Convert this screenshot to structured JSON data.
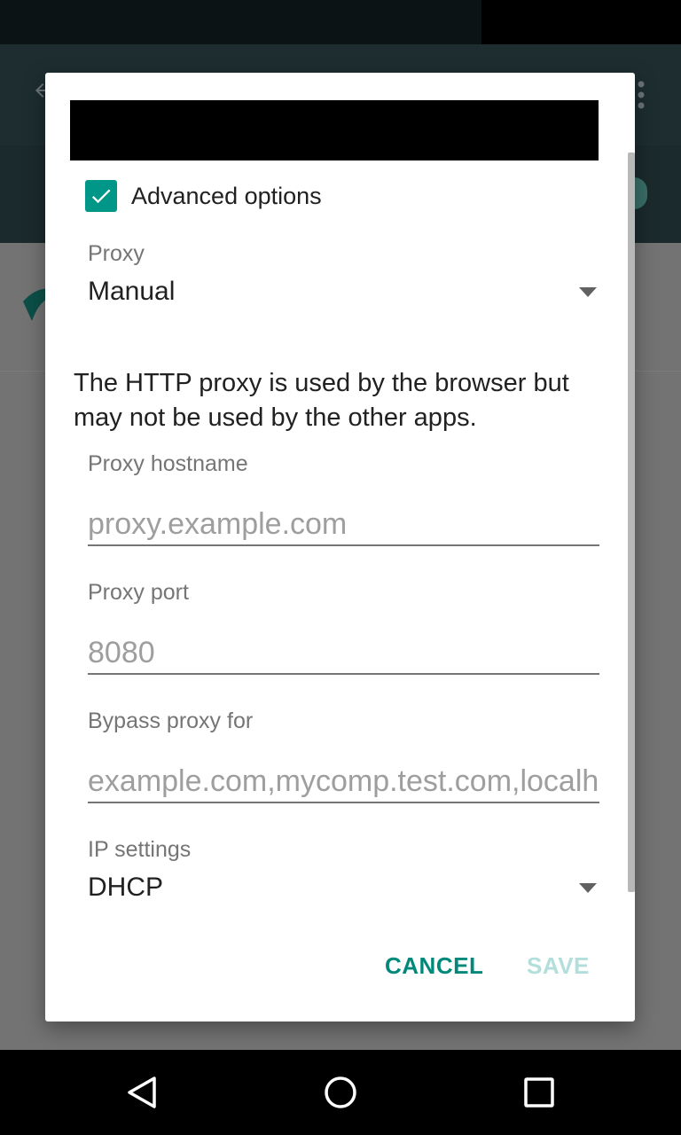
{
  "dialog": {
    "advanced_options_label": "Advanced options",
    "advanced_options_checked": true,
    "proxy": {
      "label": "Proxy",
      "value": "Manual"
    },
    "info_text": "The HTTP proxy is used by the browser but may not be used by the other apps.",
    "proxy_hostname": {
      "label": "Proxy hostname",
      "placeholder": "proxy.example.com"
    },
    "proxy_port": {
      "label": "Proxy port",
      "placeholder": "8080"
    },
    "bypass_proxy": {
      "label": "Bypass proxy for",
      "placeholder": "example.com,mycomp.test.com,localhost"
    },
    "ip_settings": {
      "label": "IP settings",
      "value": "DHCP"
    },
    "buttons": {
      "cancel": "CANCEL",
      "save": "SAVE"
    }
  },
  "colors": {
    "accent": "#009688",
    "accent_disabled": "#b2dfdb",
    "app_bar": "#1d2d30",
    "scrim": "#737373"
  },
  "icons": {
    "nav_back": "back-triangle-icon",
    "nav_home": "home-circle-icon",
    "nav_recents": "recents-square-icon",
    "checkbox": "check-icon",
    "dropdown": "dropdown-arrow-icon"
  }
}
